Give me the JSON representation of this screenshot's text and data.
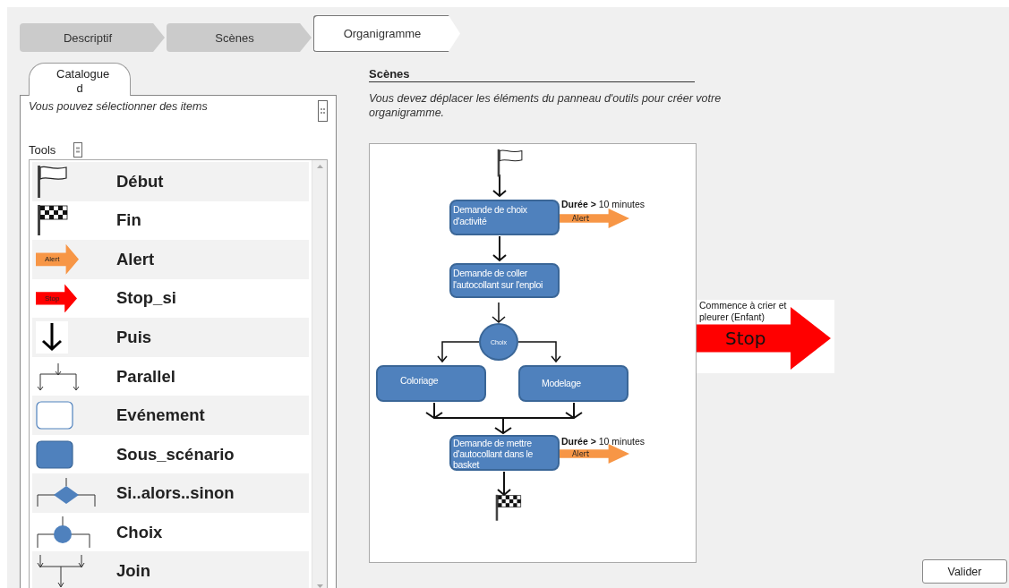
{
  "steps": [
    {
      "label": "Descriptif",
      "selected": false
    },
    {
      "label": "Scènes",
      "selected": false
    },
    {
      "label": "Organigramme",
      "selected": true
    }
  ],
  "catalog": {
    "tab": "Catalogue d",
    "hint": "Vous pouvez sélectionner des items",
    "tools_label": "Tools",
    "items": [
      {
        "label": "Début",
        "kind": "start"
      },
      {
        "label": "Fin",
        "kind": "finish"
      },
      {
        "label": "Alert",
        "kind": "alert",
        "icon_text": "Alert"
      },
      {
        "label": "Stop_si",
        "kind": "stop",
        "icon_text": "Stop"
      },
      {
        "label": "Puis",
        "kind": "then"
      },
      {
        "label": "Parallel",
        "kind": "parallel"
      },
      {
        "label": "Evénement",
        "kind": "event"
      },
      {
        "label": "Sous_scénario",
        "kind": "subscenario"
      },
      {
        "label": "Si..alors..sinon",
        "kind": "condition"
      },
      {
        "label": "Choix",
        "kind": "choice"
      },
      {
        "label": "Join",
        "kind": "join"
      }
    ]
  },
  "scenes": {
    "title": "Scènes",
    "description": "Vous devez déplacer les éléments du panneau d'outils pour créer votre organigramme."
  },
  "diagram": {
    "tasks": [
      {
        "text": "Demande de choix d'activité"
      },
      {
        "text": "Demande de coller l'autocollant sur l'enploi"
      },
      {
        "text": "Coloriage"
      },
      {
        "text": "Modelage"
      },
      {
        "text": "Demande de mettre d'autocollant dans le basket"
      }
    ],
    "choice": "Choix",
    "alerts": [
      {
        "condition": "**Durée >** 10 minutes",
        "label": "Alert"
      },
      {
        "condition": "**Durée >** 10 minutes",
        "label": "Alert"
      }
    ]
  },
  "stop_rule": {
    "text": "Commence à crier et pleurer (Enfant)",
    "label": "Stop"
  },
  "validate": "Valider"
}
